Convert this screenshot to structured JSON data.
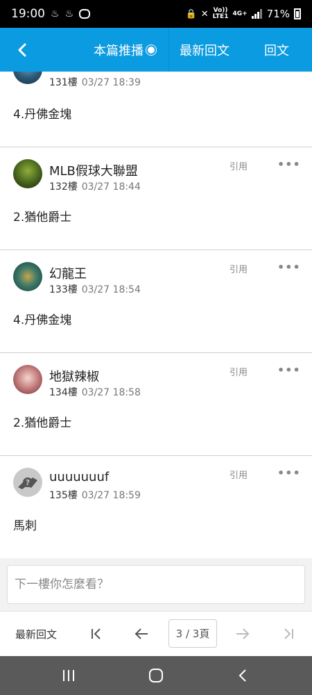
{
  "status_bar": {
    "time": "19:00",
    "network_volte": "Vo))",
    "network_lte": "LTE1",
    "network_4g": "4G+",
    "battery": "71%"
  },
  "header": {
    "back_icon": "chevron-left-icon",
    "tabs": {
      "push": "本篇推播",
      "latest": "最新回文",
      "reply": "回文"
    }
  },
  "posts": [
    {
      "floor": "131樓",
      "time": "03/27 18:39",
      "content": "4.丹佛金塊"
    },
    {
      "author": "MLB假球大聯盟",
      "floor": "132樓",
      "time": "03/27 18:44",
      "content": "2.猶他爵士",
      "quote": "引用",
      "more": "•••"
    },
    {
      "author": "幻龍王",
      "floor": "133樓",
      "time": "03/27 18:54",
      "content": "4.丹佛金塊",
      "quote": "引用",
      "more": "•••"
    },
    {
      "author": "地獄辣椒",
      "floor": "134樓",
      "time": "03/27 18:58",
      "content": "2.猶他爵士",
      "quote": "引用",
      "more": "•••"
    },
    {
      "author": "uuuuuuuf",
      "floor": "135樓",
      "time": "03/27 18:59",
      "content": "馬刺",
      "quote": "引用",
      "more": "•••"
    }
  ],
  "reply_box": {
    "placeholder": "下一樓你怎麼看？"
  },
  "pager": {
    "latest": "最新回文",
    "page_indicator": "3 / 3頁"
  },
  "colors": {
    "header_bg": "#0b9be0",
    "nav_bar_bg": "#5a5a5a"
  }
}
